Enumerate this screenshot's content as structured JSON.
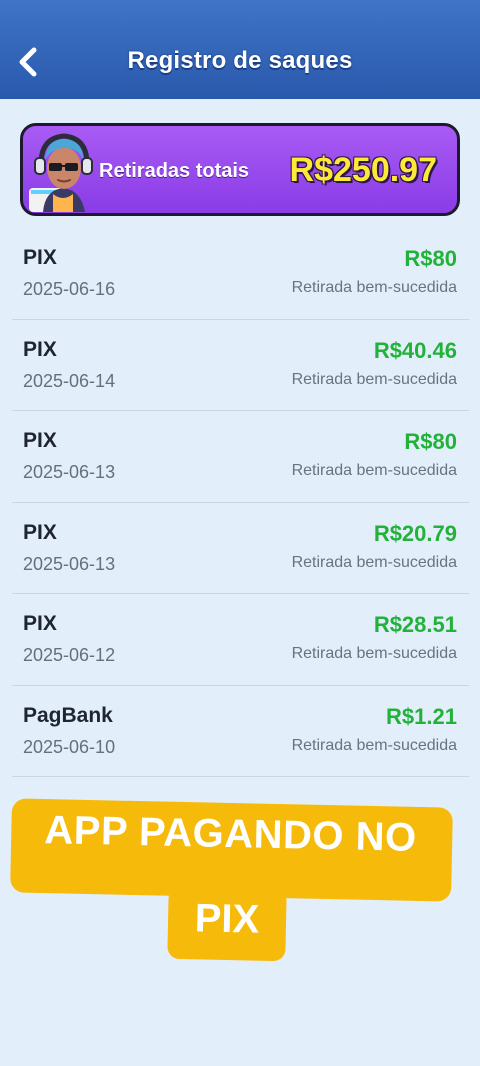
{
  "header": {
    "title": "Registro de saques",
    "back_icon": "chevron-left-icon"
  },
  "summary": {
    "label": "Retiradas totais",
    "value": "R$250.97",
    "avatar_icon": "avatar-headphones-icon"
  },
  "withdrawals": [
    {
      "method": "PIX",
      "date": "2025-06-16",
      "amount": "R$80",
      "status": "Retirada bem-sucedida"
    },
    {
      "method": "PIX",
      "date": "2025-06-14",
      "amount": "R$40.46",
      "status": "Retirada bem-sucedida"
    },
    {
      "method": "PIX",
      "date": "2025-06-13",
      "amount": "R$80",
      "status": "Retirada bem-sucedida"
    },
    {
      "method": "PIX",
      "date": "2025-06-13",
      "amount": "R$20.79",
      "status": "Retirada bem-sucedida"
    },
    {
      "method": "PIX",
      "date": "2025-06-12",
      "amount": "R$28.51",
      "status": "Retirada bem-sucedida"
    },
    {
      "method": "PagBank",
      "date": "2025-06-10",
      "amount": "R$1.21",
      "status": "Retirada bem-sucedida"
    }
  ],
  "promo": {
    "line1": "APP PAGANDO NO",
    "line2": "PIX"
  },
  "colors": {
    "header": "#2f63b6",
    "background": "#e2effb",
    "card": "#9a4cee",
    "card_value": "#ffe838",
    "amount": "#22b23a",
    "promo": "#f6ba0a"
  }
}
